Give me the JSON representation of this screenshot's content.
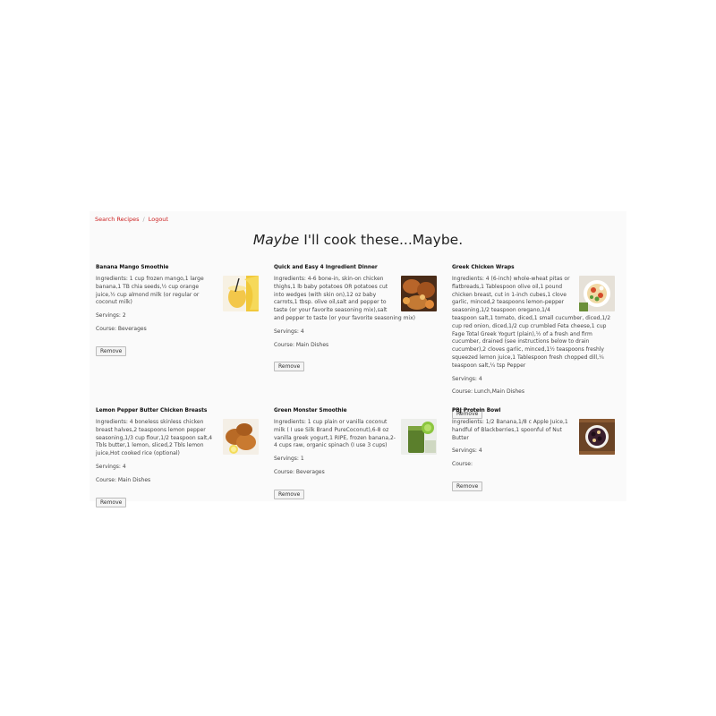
{
  "nav": {
    "search": "Search Recipes",
    "separator": "/",
    "logout": "Logout"
  },
  "page_title": {
    "emph": "Maybe",
    "rest": " I'll cook these...Maybe."
  },
  "remove_label": "Remove",
  "recipes": [
    {
      "name": "Banana Mango Smoothie",
      "ingredients": "Ingredients: 1 cup frozen mango,1 large banana,1 TB chia seeds,½ cup orange juice,½ cup almond milk (or regular or coconut milk)",
      "servings": "Servings: 2",
      "course": "Course: Beverages",
      "icon": "smoothie-image"
    },
    {
      "name": "Quick and Easy 4 Ingredient Dinner",
      "ingredients": "Ingredients: 4-6 bone-in, skin-on chicken thighs,1 lb baby potatoes OR potatoes cut into wedges (with skin on),12 oz baby carrots,1 tbsp. olive oil,salt and pepper to taste (or your favorite seasoning mix),salt and pepper to taste (or your favorite seasoning mix)",
      "servings": "Servings: 4",
      "course": "Course: Main Dishes",
      "icon": "chicken-dinner-image"
    },
    {
      "name": "Greek Chicken Wraps",
      "ingredients": "Ingredients: 4 (6-inch) whole-wheat pitas or flatbreads,1 Tablespoon olive oil,1 pound chicken breast, cut in 1-inch cubes,1 clove garlic, minced,2 teaspoons lemon-pepper seasoning,1/2 teaspoon oregano,1/4 teaspoon salt,1 tomato, diced,1 small cucumber, diced,1/2 cup red onion, diced,1/2 cup crumbled Feta cheese,1 cup Fage Total Greek Yogurt (plain),½ of a fresh and firm cucumber, drained (see instructions below to drain cucumber),2 cloves garlic, minced,1½ teaspoons freshly squeezed lemon juice,1 Tablespoon fresh chopped dill,¼ teaspoon salt,¼ tsp Pepper",
      "servings": "Servings: 4",
      "course": "Course: Lunch,Main Dishes",
      "icon": "greek-wrap-image"
    },
    {
      "name": "Lemon Pepper Butter Chicken Breasts",
      "ingredients": "Ingredients: 4 boneless skinless chicken breast halves,2 teaspoons lemon pepper seasoning,1/3 cup flour,1/2 teaspoon salt,4 Tbls butter,1 lemon, sliced,2 Tbls lemon juice,Hot cooked rice (optional)",
      "servings": "Servings: 4",
      "course": "Course: Main Dishes",
      "icon": "lemon-chicken-image"
    },
    {
      "name": "Green Monster Smoothie",
      "ingredients": "Ingredients: 1 cup plain or vanilla coconut milk ( I use Silk Brand PureCoconut),6-8 oz vanilla greek yogurt,1 RIPE, frozen banana,2-4 cups raw, organic spinach (I use 3 cups)",
      "servings": "Servings: 1",
      "course": "Course: Beverages",
      "icon": "green-smoothie-image"
    },
    {
      "name": "PBJ Protein Bowl",
      "ingredients": "Ingredients: 1/2 Banana,1/8 c Apple Juice,1 handful of Blackberries,1 spoonful of Nut Butter",
      "servings": "Servings: 4",
      "course": "Course:",
      "icon": "pbj-bowl-image"
    }
  ],
  "colors": {
    "link": "#cc2222",
    "background": "#fafafa"
  }
}
